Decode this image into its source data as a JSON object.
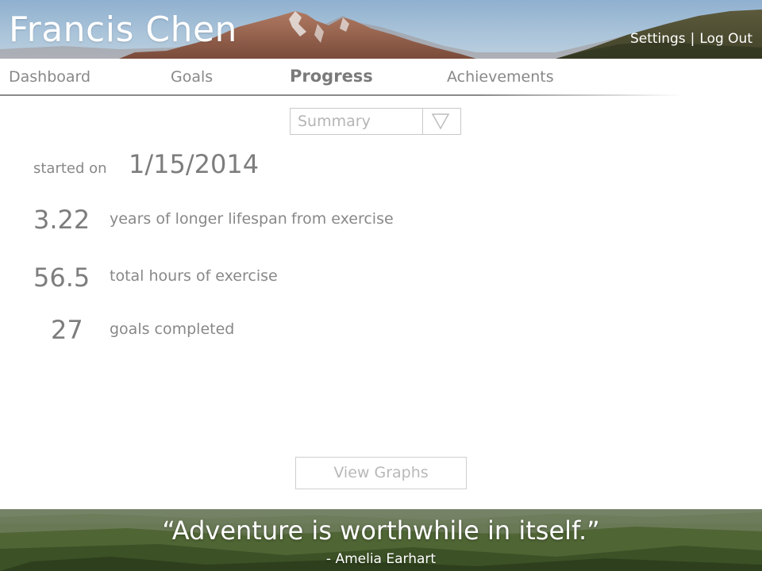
{
  "header": {
    "user_name": "Francis Chen",
    "settings_label": "Settings",
    "separator": "|",
    "logout_label": "Log Out"
  },
  "nav": {
    "tabs": [
      {
        "label": "Dashboard",
        "active": false
      },
      {
        "label": "Goals",
        "active": false
      },
      {
        "label": "Progress",
        "active": true
      },
      {
        "label": "Achievements",
        "active": false
      }
    ]
  },
  "view_select": {
    "selected": "Summary",
    "arrow_icon": "triangle-down-outline-icon"
  },
  "summary": {
    "started_label": "started on",
    "started_date": "1/15/2014",
    "stats": [
      {
        "value": "3.22",
        "label": "years of longer lifespan",
        "label_extra": "from exercise"
      },
      {
        "value": "56.5",
        "label": "total hours of exercise"
      },
      {
        "value": "27",
        "label": "goals completed"
      }
    ]
  },
  "actions": {
    "view_graphs_label": "View Graphs"
  },
  "footer": {
    "quote": "“Adventure is worthwhile in itself.”",
    "author": "- Amelia Earhart"
  },
  "colors": {
    "text_gray": "#888888",
    "banner_text": "#ffffff",
    "nav_rule": "#8a8a8a",
    "control_border": "#c9c9c9"
  }
}
